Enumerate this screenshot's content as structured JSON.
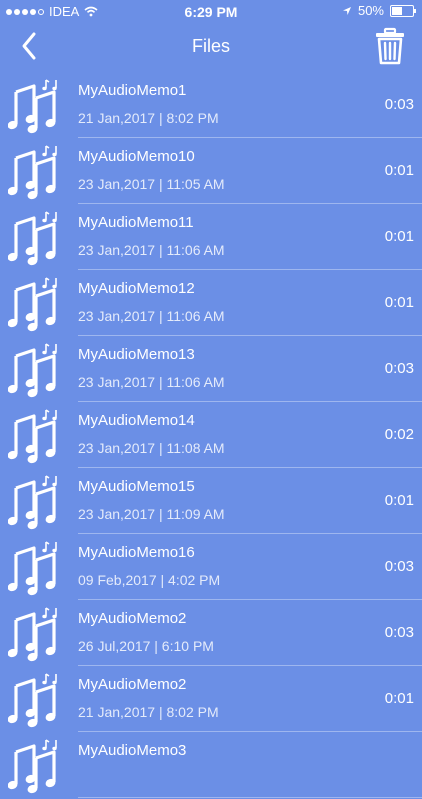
{
  "status_bar": {
    "carrier": "IDEA",
    "time": "6:29 PM",
    "battery": "50%"
  },
  "navbar": {
    "title": "Files"
  },
  "files": [
    {
      "name": "MyAudioMemo1",
      "date": "21 Jan,2017 | 8:02 PM",
      "duration": "0:03"
    },
    {
      "name": "MyAudioMemo10",
      "date": "23 Jan,2017 | 11:05 AM",
      "duration": "0:01"
    },
    {
      "name": "MyAudioMemo11",
      "date": "23 Jan,2017 | 11:06 AM",
      "duration": "0:01"
    },
    {
      "name": "MyAudioMemo12",
      "date": "23 Jan,2017 | 11:06 AM",
      "duration": "0:01"
    },
    {
      "name": "MyAudioMemo13",
      "date": "23 Jan,2017 | 11:06 AM",
      "duration": "0:03"
    },
    {
      "name": "MyAudioMemo14",
      "date": "23 Jan,2017 | 11:08 AM",
      "duration": "0:02"
    },
    {
      "name": "MyAudioMemo15",
      "date": "23 Jan,2017 | 11:09 AM",
      "duration": "0:01"
    },
    {
      "name": "MyAudioMemo16",
      "date": "09 Feb,2017 | 4:02 PM",
      "duration": "0:03"
    },
    {
      "name": "MyAudioMemo2",
      "date": "26 Jul,2017 | 6:10 PM",
      "duration": "0:03"
    },
    {
      "name": "MyAudioMemo2",
      "date": "21 Jan,2017 | 8:02 PM",
      "duration": "0:01"
    },
    {
      "name": "MyAudioMemo3",
      "date": "",
      "duration": ""
    }
  ]
}
